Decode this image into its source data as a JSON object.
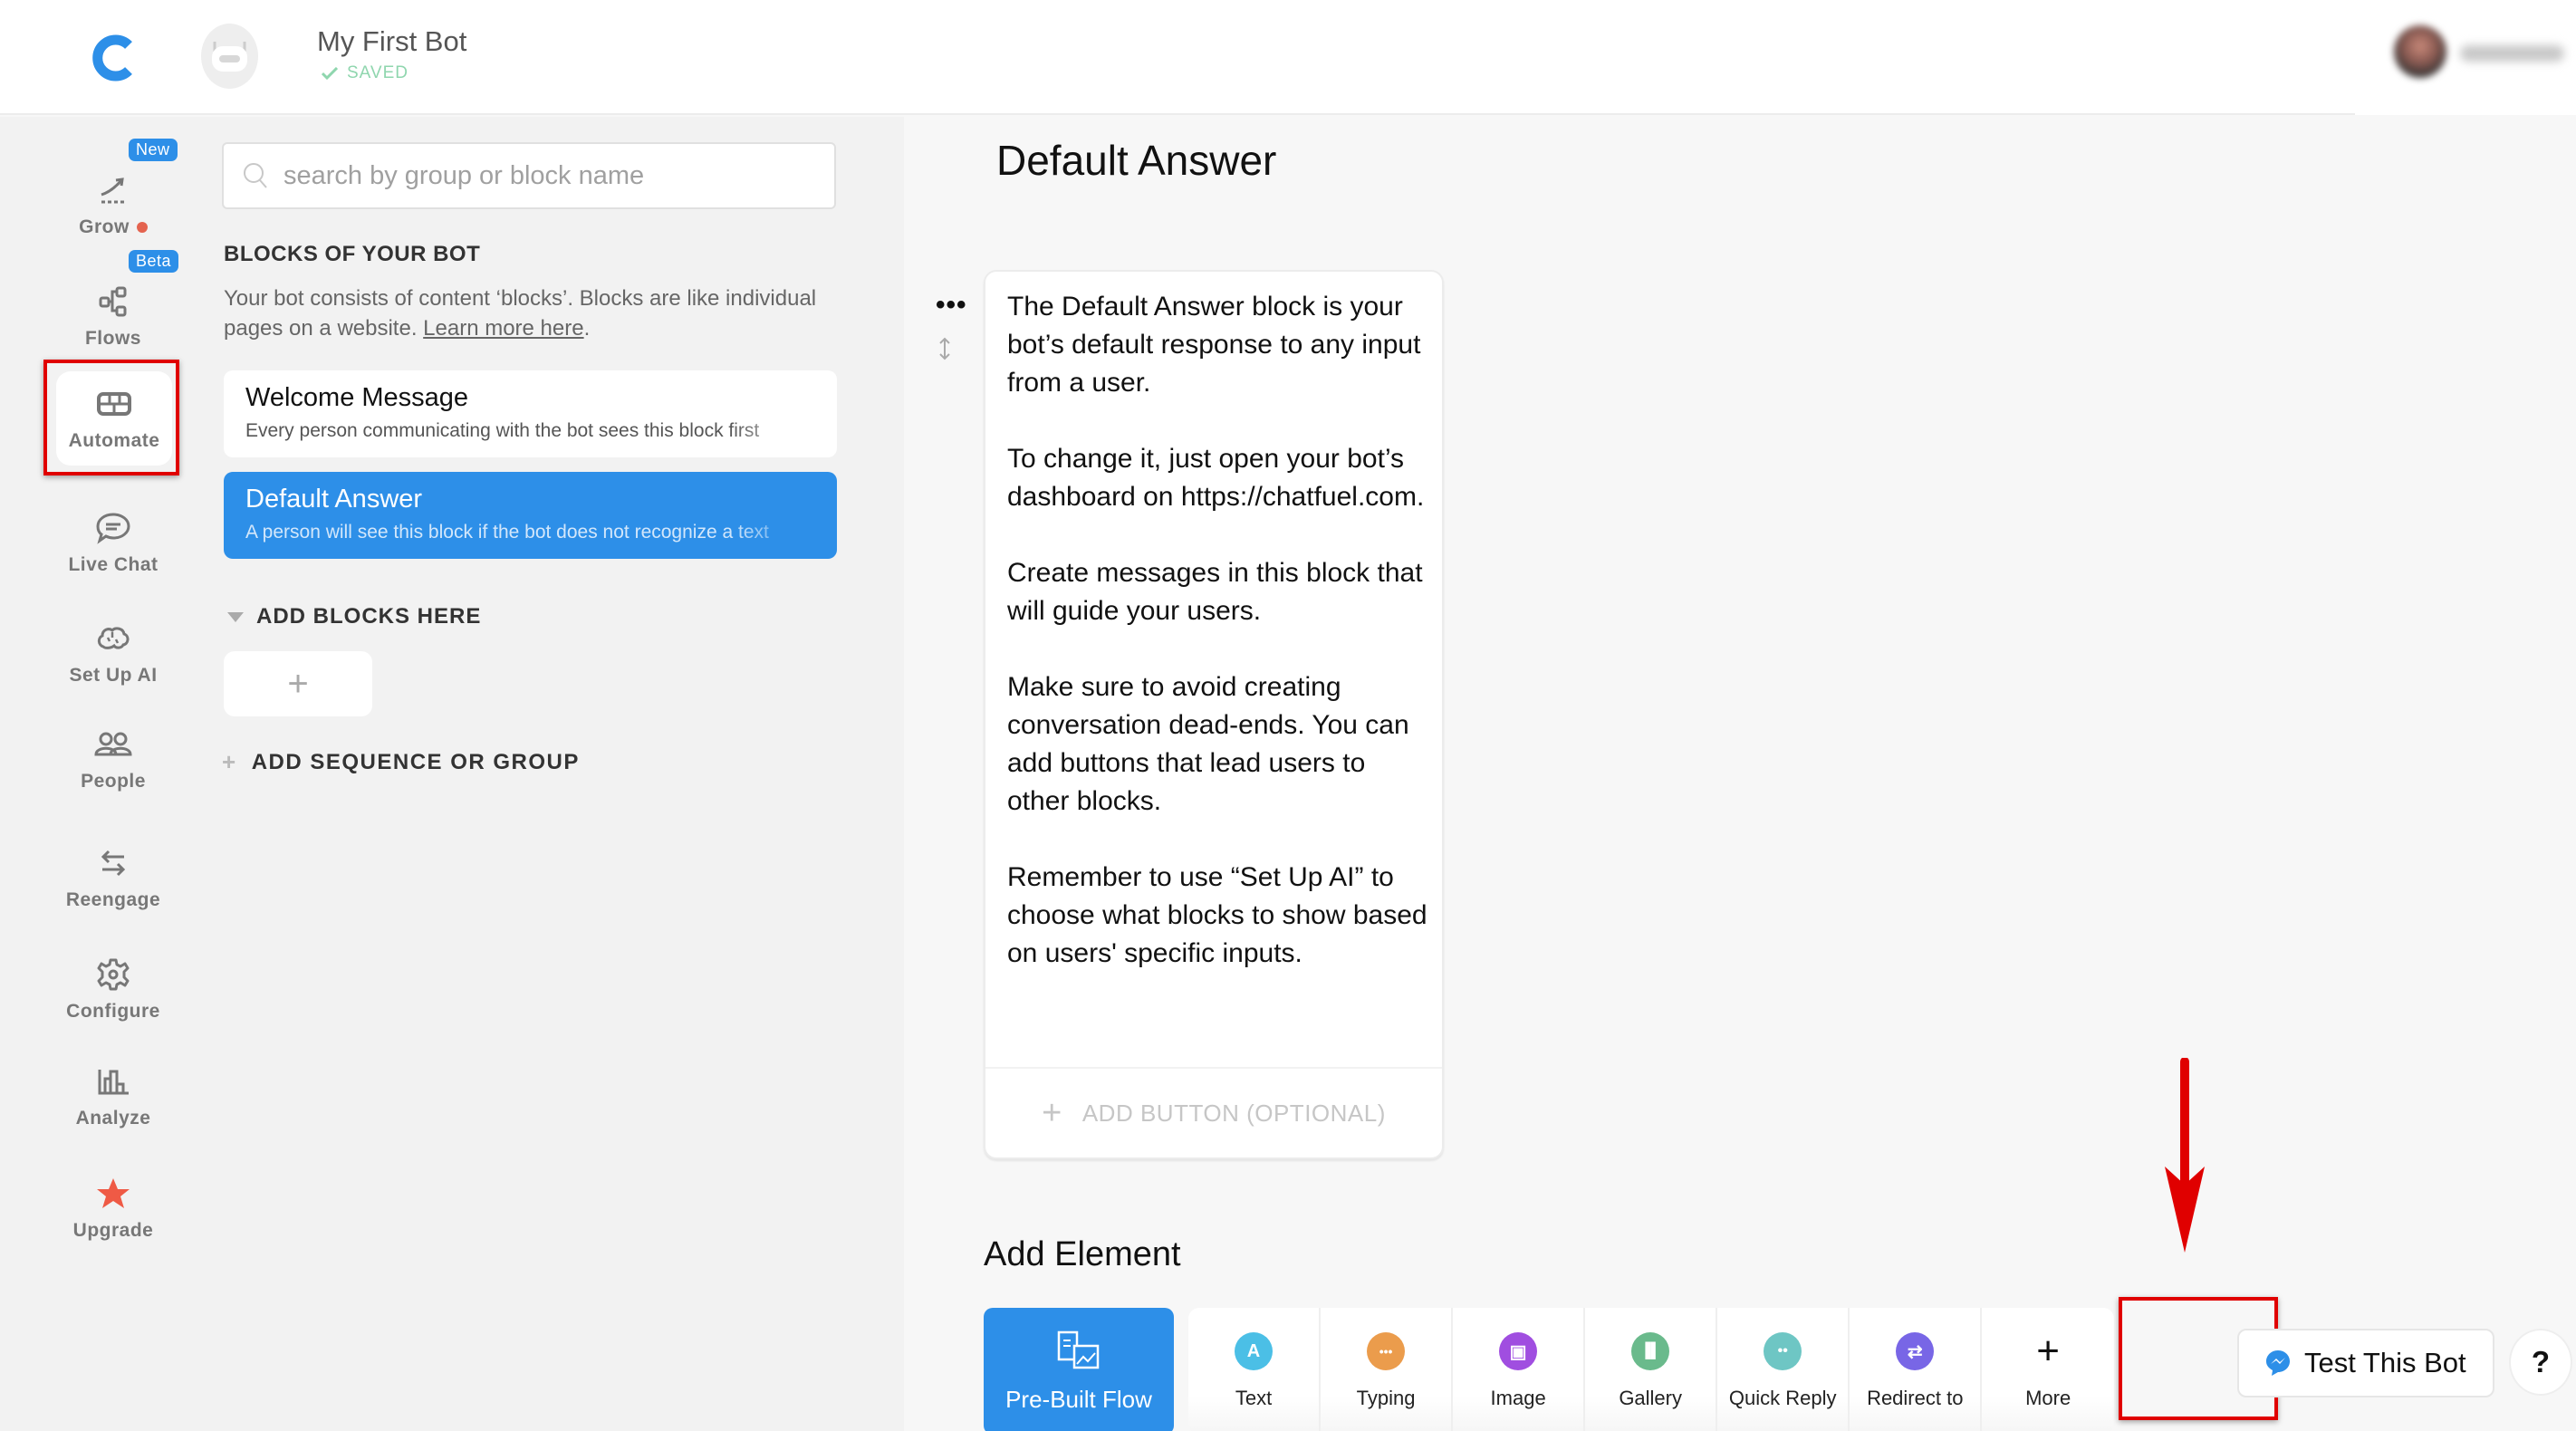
{
  "header": {
    "bot_name": "My First Bot",
    "save_status": "SAVED",
    "user_name": "(blurred)"
  },
  "nav": {
    "items": [
      {
        "id": "grow",
        "label": "Grow",
        "icon": "trend-up-icon",
        "badge": "New",
        "has_dot": true
      },
      {
        "id": "flows",
        "label": "Flows",
        "icon": "flow-nodes-icon",
        "badge": "Beta"
      },
      {
        "id": "automate",
        "label": "Automate",
        "icon": "bricks-icon",
        "active": true,
        "highlighted": true
      },
      {
        "id": "live-chat",
        "label": "Live Chat",
        "icon": "chat-bubble-icon"
      },
      {
        "id": "set-up-ai",
        "label": "Set Up AI",
        "icon": "brain-icon"
      },
      {
        "id": "people",
        "label": "People",
        "icon": "people-icon"
      },
      {
        "id": "reengage",
        "label": "Reengage",
        "icon": "swap-arrows-icon"
      },
      {
        "id": "configure",
        "label": "Configure",
        "icon": "gear-icon"
      },
      {
        "id": "analyze",
        "label": "Analyze",
        "icon": "bar-chart-icon"
      },
      {
        "id": "upgrade",
        "label": "Upgrade",
        "icon": "star-icon"
      }
    ]
  },
  "blocks_panel": {
    "search_placeholder": "search by group or block name",
    "section_title": "BLOCKS OF YOUR BOT",
    "description": "Your bot consists of content ‘blocks’. Blocks are like individual pages on a website. ",
    "learn_more": "Learn more here",
    "description_end": ".",
    "blocks": [
      {
        "title": "Welcome Message",
        "subtitle": "Every person communicating with the bot sees this block first",
        "selected": false
      },
      {
        "title": "Default Answer",
        "subtitle": "A person will see this block if the bot does not recognize a text",
        "selected": true
      }
    ],
    "add_blocks_heading": "ADD BLOCKS HERE",
    "add_block_plus": "+",
    "add_sequence_label": "ADD SEQUENCE OR GROUP"
  },
  "main": {
    "title": "Default Answer",
    "card_text": "The Default Answer block is your bot’s default response to any input from a user.\n\nTo change it, just open your bot’s dashboard on https://chatfuel.com.\n\nCreate messages in this block that will guide your users.\n\nMake sure to avoid creating conversation dead-ends. You can add buttons that lead users to other blocks.\n\nRemember to use “Set Up AI” to choose what blocks to show based on users' specific inputs.",
    "card_menu": "•••",
    "add_button_label": "ADD BUTTON (OPTIONAL)",
    "add_element_heading": "Add Element",
    "prebuilt_label": "Pre-Built Flow",
    "elements": [
      {
        "label": "Text",
        "icon": "text-icon",
        "color": "#4bbfe6",
        "glyph": "A"
      },
      {
        "label": "Typing",
        "icon": "typing-icon",
        "color": "#eb9c4c",
        "glyph": "•••"
      },
      {
        "label": "Image",
        "icon": "image-icon",
        "color": "#a04ee0",
        "glyph": "▣"
      },
      {
        "label": "Gallery",
        "icon": "gallery-icon",
        "color": "#6aba8c",
        "glyph": "▐▌"
      },
      {
        "label": "Quick Reply",
        "icon": "quick-reply-icon",
        "color": "#6ec6c4",
        "glyph": "••"
      },
      {
        "label": "Redirect to",
        "icon": "redirect-icon",
        "color": "#7866e6",
        "glyph": "⇄"
      },
      {
        "label": "More",
        "icon": "plus-icon",
        "glyph": "+"
      }
    ],
    "test_bot_label": "Test This Bot",
    "help_label": "?"
  },
  "colors": {
    "brand_blue": "#2d8fe8",
    "annotation_red": "#e00000",
    "saved_green": "#8fd6ae",
    "upgrade_star": "#ef5a45"
  }
}
